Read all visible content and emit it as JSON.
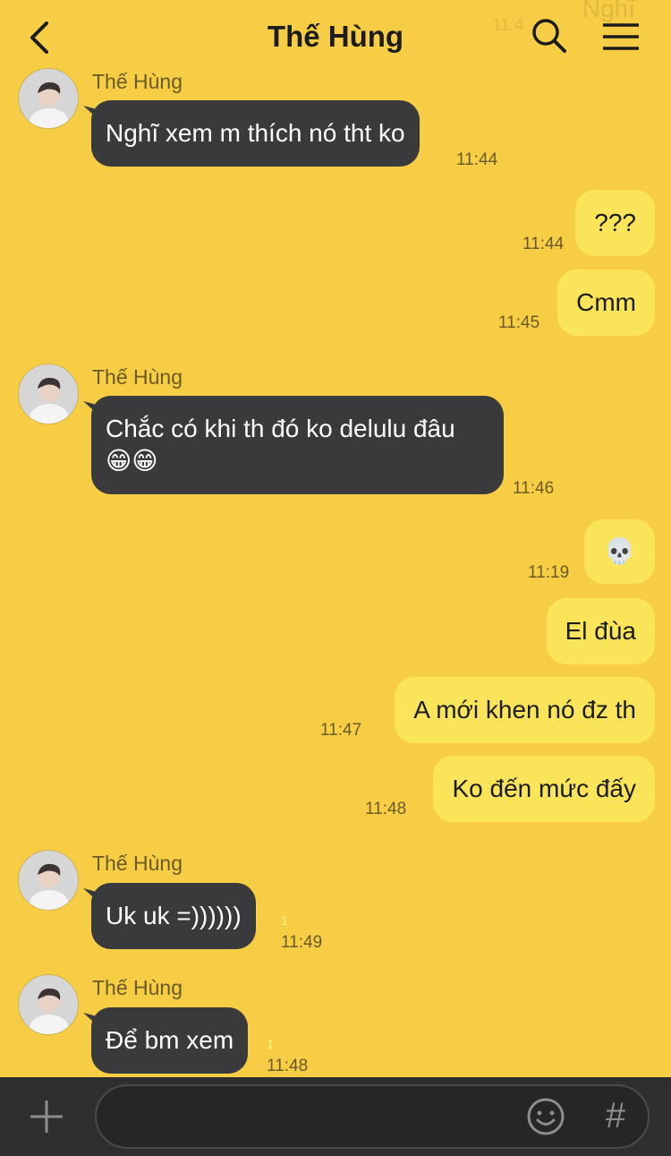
{
  "header": {
    "title": "Thế Hùng",
    "ghost_text": "Nghĩ ",
    "ghost_time": "11:4"
  },
  "messages": [
    {
      "sender": "Thế Hùng",
      "text": "Nghĩ xem m thích nó tht ko",
      "time": "11:44"
    },
    {
      "text": "???",
      "time": "11:44"
    },
    {
      "text": "Cmm",
      "time": "11:45"
    },
    {
      "sender": "Thế Hùng",
      "text": "Chắc có khi th đó ko delulu đâu",
      "emoji": "😁😁",
      "time": "11:46"
    },
    {
      "emoji": "💀",
      "time": "11:19"
    },
    {
      "text": "El đùa",
      "time": ""
    },
    {
      "text": "A mới khen nó đz th",
      "time": "11:47"
    },
    {
      "text": "Ko đến mức đấy",
      "time": "11:48"
    },
    {
      "sender": "Thế Hùng",
      "text": "Uk uk =))))))",
      "unread": "1",
      "time": "11:49"
    },
    {
      "sender": "Thế Hùng",
      "text": "Để bm xem",
      "unread": "1",
      "time": "11:48"
    }
  ],
  "input": {
    "placeholder": "",
    "hash_label": "#"
  },
  "colors": {
    "background": "#f7cd45",
    "incoming": "#3a3a3c",
    "outgoing": "#fae55a",
    "input_bar": "#2f2f30"
  }
}
